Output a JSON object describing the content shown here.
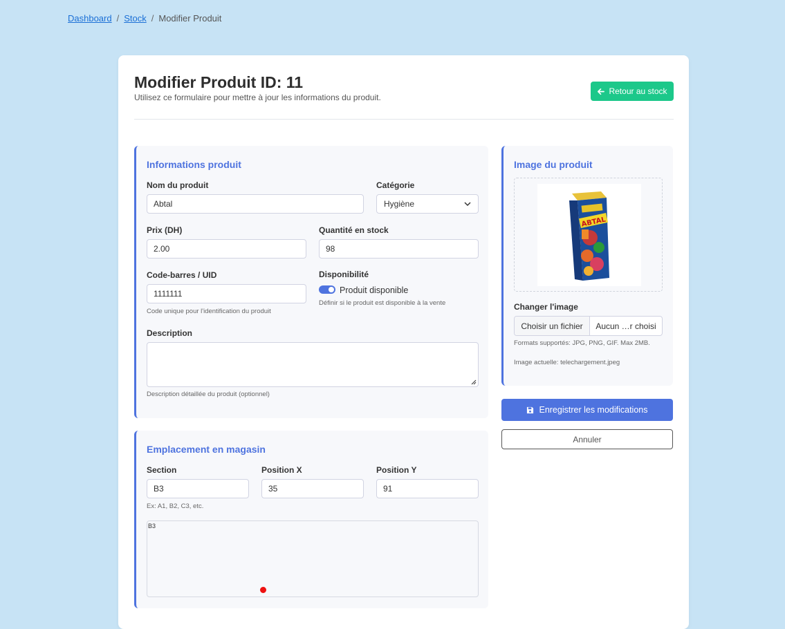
{
  "breadcrumb": {
    "items": [
      "Dashboard",
      "Stock"
    ],
    "current": "Modifier Produit",
    "separator": "/"
  },
  "header": {
    "title": "Modifier Produit ID: 11",
    "subtitle": "Utilisez ce formulaire pour mettre à jour les informations du produit.",
    "back_button": "Retour au stock"
  },
  "info": {
    "title": "Informations produit",
    "name_label": "Nom du produit",
    "name_value": "Abtal",
    "category_label": "Catégorie",
    "category_value": "Hygiène",
    "price_label": "Prix (DH)",
    "price_value": "2.00",
    "qty_label": "Quantité en stock",
    "qty_value": "98",
    "barcode_label": "Code-barres / UID",
    "barcode_value": "1111111",
    "barcode_help": "Code unique pour l'identification du produit",
    "availability_label": "Disponibilité",
    "availability_toggle_label": "Produit disponible",
    "availability_on": true,
    "availability_help": "Définir si le produit est disponible à la vente",
    "description_label": "Description",
    "description_value": "",
    "description_help": "Description détaillée du produit (optionnel)"
  },
  "location": {
    "title": "Emplacement en magasin",
    "section_label": "Section",
    "section_value": "B3",
    "section_help": "Ex: A1, B2, C3, etc.",
    "posx_label": "Position X",
    "posx_value": "35",
    "posy_label": "Position Y",
    "posy_value": "91",
    "map_label": "B3"
  },
  "image": {
    "title": "Image du produit",
    "change_label": "Changer l'image",
    "choose_button": "Choisir un fichier",
    "no_file": "Aucun …r choisi",
    "formats": "Formats supportés: JPG, PNG, GIF. Max 2MB.",
    "current": "Image actuelle: telechargement.jpeg",
    "packaging_brand": "Valencia",
    "packaging_name": "ABTAL"
  },
  "actions": {
    "save": "Enregistrer les modifications",
    "cancel": "Annuler"
  },
  "colors": {
    "accent": "#4e73df",
    "success": "#1cc88a",
    "marker": "#ee1111",
    "background": "#c7e3f5"
  },
  "icons": {
    "back": "arrow-left-icon",
    "save": "save-icon",
    "select": "chevron-down-icon"
  }
}
